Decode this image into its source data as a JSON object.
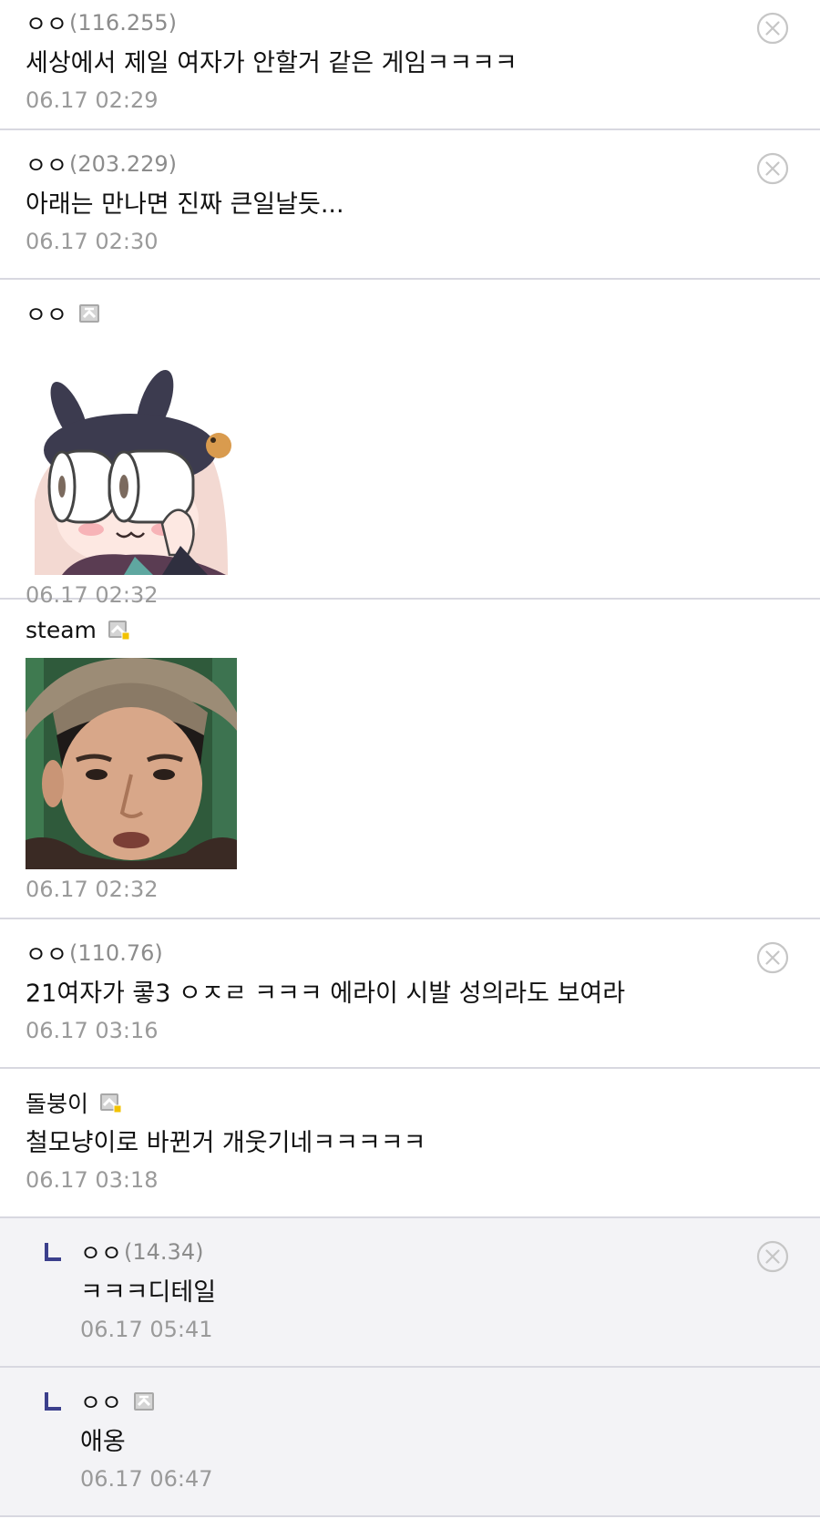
{
  "comments": [
    {
      "name": "ㅇㅇ",
      "ip": "(116.255)",
      "text": "세상에서 제일 여자가 안할거 같은 게임ㅋㅋㅋㅋ",
      "time": "06.17 02:29"
    },
    {
      "name": "ㅇㅇ",
      "ip": "(203.229)",
      "text": "아래는 만나면 진짜 큰일날듯...",
      "time": "06.17 02:30"
    },
    {
      "name": "ㅇㅇ",
      "time": "06.17 02:32",
      "image": "dccon-bunny-binoculars"
    },
    {
      "name": "steam",
      "time": "06.17 02:32",
      "image": "dccon-man-hat-face"
    },
    {
      "name": "ㅇㅇ",
      "ip": "(110.76)",
      "text": "21여자가 콯3 ㅇㅈㄹ ㅋㅋㅋ 에라이 시발 성의라도 보여라",
      "time": "06.17 03:16"
    },
    {
      "name": "돌붕이",
      "text": "철모냥이로 바뀐거 개웃기네ㅋㅋㅋㅋㅋ",
      "time": "06.17 03:18"
    },
    {
      "name": "ㅇㅇ",
      "ip": "(14.34)",
      "text": "ㅋㅋㅋ디테일",
      "time": "06.17 05:41"
    },
    {
      "name": "ㅇㅇ",
      "text": "애옹",
      "time": "06.17 06:47"
    }
  ],
  "icons": {
    "delete": "close-circle-icon",
    "fixed_nick": "fixed-nickname-icon",
    "reply": "reply-arrow-icon"
  },
  "colors": {
    "divider": "#d8d8e0",
    "reply_bg": "#f3f3f6",
    "muted": "#9a9a9a",
    "reply_arrow": "#3b3f8c",
    "sub_nick_badge": "#f2c200"
  }
}
